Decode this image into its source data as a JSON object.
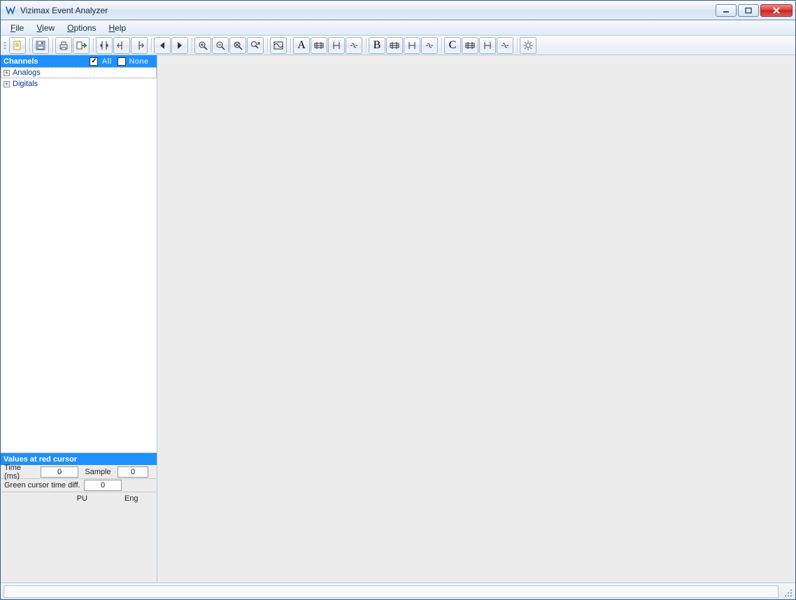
{
  "window": {
    "title": "Vizimax Event Analyzer"
  },
  "menu": {
    "file": "File",
    "view": "View",
    "options": "Options",
    "help": "Help"
  },
  "toolbar": {
    "letterA": "A",
    "letterB": "B",
    "letterC": "C"
  },
  "channels": {
    "header": "Channels",
    "all": "All",
    "none": "None",
    "items": [
      {
        "label": "Analogs"
      },
      {
        "label": "Digitals"
      }
    ]
  },
  "values_panel": {
    "header": "Values at red cursor",
    "time_label": "Time (ms)",
    "time_value": "0",
    "sample_label": "Sample",
    "sample_value": "0",
    "green_label": "Green cursor time diff.",
    "green_value": "0",
    "pu_label": "PU",
    "eng_label": "Eng"
  }
}
